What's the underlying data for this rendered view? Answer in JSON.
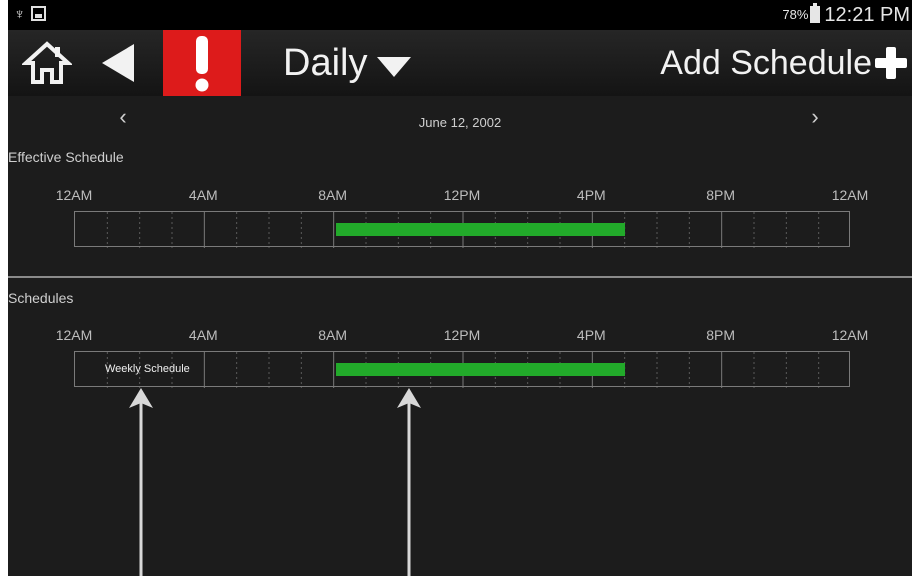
{
  "status": {
    "usb_icon": "usb-icon",
    "image_icon": "image-icon",
    "battery_pct": "78%",
    "time": "12:21 PM"
  },
  "nav": {
    "home_icon": "home-icon",
    "back_icon": "back-arrow-icon",
    "alert_icon": "exclamation-icon",
    "view_mode": "Daily",
    "add_schedule": "Add Schedule"
  },
  "date_nav": {
    "prev": "‹",
    "next": "›",
    "date": "June 12, 2002"
  },
  "effective": {
    "title": "Effective Schedule",
    "hour_labels": [
      "12AM",
      "4AM",
      "8AM",
      "12PM",
      "4PM",
      "8PM",
      "12AM"
    ],
    "active_start_hour": 8,
    "active_end_hour": 17,
    "bar_color": "#22aa2a"
  },
  "schedules": {
    "title": "Schedules",
    "hour_labels": [
      "12AM",
      "4AM",
      "8AM",
      "12PM",
      "4PM",
      "8PM",
      "12AM"
    ],
    "items": [
      {
        "name": "Weekly Schedule",
        "active_start_hour": 8,
        "active_end_hour": 17,
        "bar_color": "#22aa2a"
      }
    ]
  },
  "colors": {
    "alert_red": "#dd1b1b",
    "background": "#1c1c1c"
  }
}
